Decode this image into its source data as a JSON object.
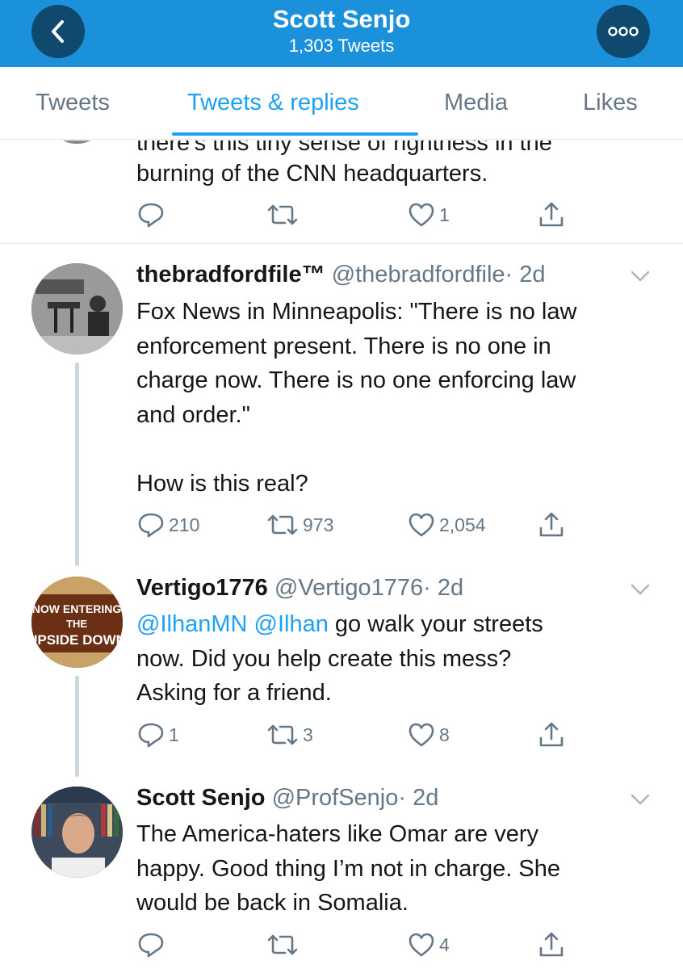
{
  "header": {
    "title": "Scott Senjo",
    "subtitle": "1,303 Tweets"
  },
  "tabs": [
    {
      "label": "Tweets",
      "active": false
    },
    {
      "label": "Tweets & replies",
      "active": true
    },
    {
      "label": "Media",
      "active": false
    },
    {
      "label": "Likes",
      "active": false
    }
  ],
  "tweets": [
    {
      "text_cut": "there's this tiny sense of rightness in the",
      "text": "burning of the CNN headquarters.",
      "replies": "",
      "retweets": "",
      "likes": "1"
    },
    {
      "name": "thebradfordfile™",
      "handle": "@thebradfordfile",
      "time": "· 2d",
      "text_lines": [
        "Fox News in Minneapolis: \"There is no law",
        "enforcement present. There is no one in",
        "charge now. There is no one enforcing law",
        "and order.\"",
        "",
        "How is this real?"
      ],
      "replies": "210",
      "retweets": "973",
      "likes": "2,054"
    },
    {
      "name": "Vertigo1776",
      "handle": "@Vertigo1776",
      "time": "· 2d",
      "mention1": "@IlhanMN",
      "mention2": "@Ilhan",
      "text_after_mentions": " go walk your streets",
      "text_lines": [
        "now. Did you help create this mess?",
        "Asking for a friend."
      ],
      "avatar_text": [
        "NOW ENTERING",
        "THE",
        "UPSIDE DOWN"
      ],
      "replies": "1",
      "retweets": "3",
      "likes": "8"
    },
    {
      "name": "Scott Senjo",
      "handle": "@ProfSenjo",
      "time": "· 2d",
      "text_lines": [
        "The America-haters like Omar are very",
        "happy.  Good thing I’m not in charge.  She",
        "would be back in Somalia."
      ],
      "replies": "",
      "retweets": "",
      "likes": "4"
    }
  ],
  "colors": {
    "header_bg": "#1a91da",
    "accent": "#1da1f2",
    "muted": "#657786"
  }
}
